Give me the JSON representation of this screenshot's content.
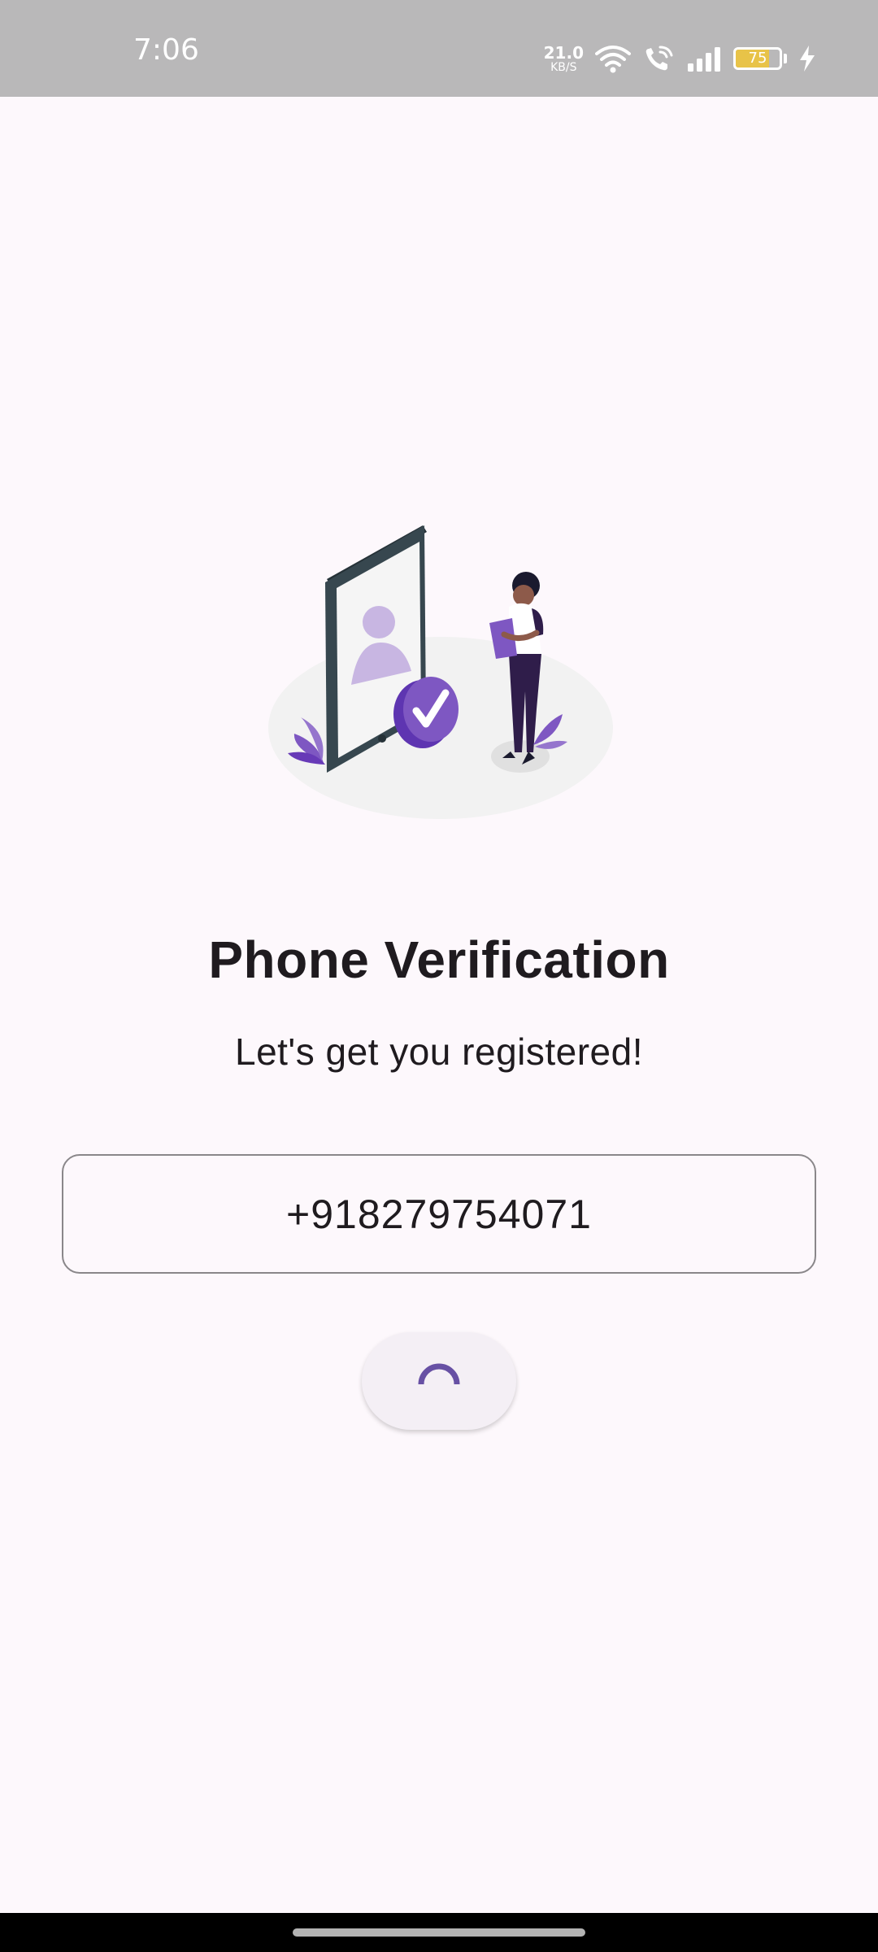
{
  "status_bar": {
    "time": "7:06",
    "net_speed_value": "21.0",
    "net_speed_unit": "KB/S",
    "battery_level": "75",
    "battery_fill_fraction": 0.75,
    "icons": [
      "wifi-icon",
      "wifi-calling-icon",
      "signal-icon",
      "battery-icon",
      "charging-icon"
    ]
  },
  "main": {
    "title": "Phone Verification",
    "subtitle": "Let's get you registered!",
    "phone_input": {
      "value": "+918279754071"
    },
    "submit_button": {
      "state": "loading",
      "icon": "spinner-icon"
    }
  },
  "colors": {
    "accent": "#6750a4",
    "illustration_purple": "#7e57c2",
    "background": "#fdf8fc",
    "status_bar": "#b9b8b9"
  }
}
